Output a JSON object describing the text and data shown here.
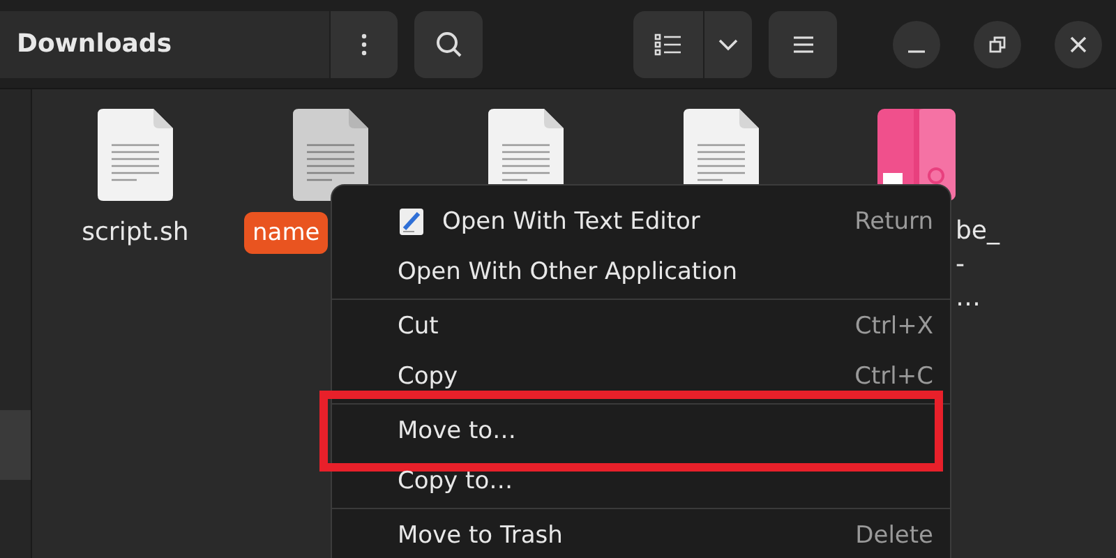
{
  "header": {
    "title": "Downloads"
  },
  "sidebar": {
    "items": [
      {
        "selected": true
      }
    ]
  },
  "files": [
    {
      "kind": "text",
      "label": [
        "script.sh"
      ],
      "selected": false
    },
    {
      "kind": "text",
      "label": [
        "name"
      ],
      "selected": true
    },
    {
      "kind": "text",
      "selected": false
    },
    {
      "kind": "text",
      "selected": false
    },
    {
      "kind": "archive",
      "label": [
        "be_",
        "-",
        "…"
      ],
      "selected": false
    }
  ],
  "context_menu": {
    "groups": [
      [
        {
          "kind": "with-icon",
          "label": "Open With Text Editor",
          "shortcut": "Return",
          "highlighted": false
        },
        {
          "kind": "plain",
          "label": "Open With Other Application",
          "highlighted": false
        }
      ],
      [
        {
          "kind": "plain",
          "label": "Cut",
          "shortcut": "Ctrl+X",
          "highlighted": false
        },
        {
          "kind": "plain",
          "label": "Copy",
          "shortcut": "Ctrl+C",
          "highlighted": false
        }
      ],
      [
        {
          "kind": "plain",
          "label": "Move to…",
          "highlighted": true
        },
        {
          "kind": "plain",
          "label": "Copy to…",
          "highlighted": false
        }
      ],
      [
        {
          "kind": "plain",
          "label": "Move to Trash",
          "shortcut": "Delete",
          "highlighted": false
        }
      ]
    ]
  }
}
